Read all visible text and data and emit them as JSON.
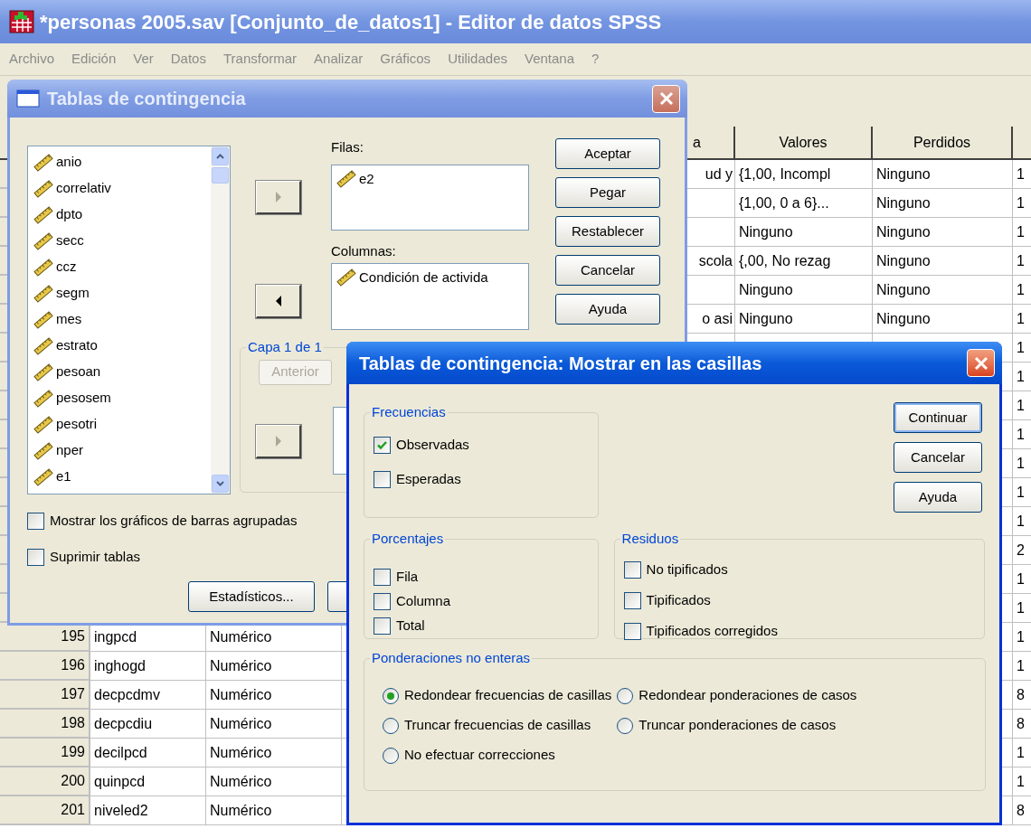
{
  "window": {
    "title": "*personas 2005.sav [Conjunto_de_datos1] - Editor de datos SPSS"
  },
  "menu": [
    "Archivo",
    "Edición",
    "Ver",
    "Datos",
    "Transformar",
    "Analizar",
    "Gráficos",
    "Utilidades",
    "Ventana",
    "?"
  ],
  "grid": {
    "headers": {
      "column_6": "a",
      "valores": "Valores",
      "perdidos": "Perdidos"
    },
    "rows": [
      {
        "column_6": "ud y",
        "valores": "{1,00, Incompl",
        "perdidos": "Ninguno",
        "column_9": "1"
      },
      {
        "valores": "{1,00, 0 a 6}...",
        "perdidos": "Ninguno",
        "column_9": "1"
      },
      {
        "valores": "Ninguno",
        "perdidos": "Ninguno",
        "column_9": "1"
      },
      {
        "column_6": "scola",
        "valores": "{,00, No rezag",
        "perdidos": "Ninguno",
        "column_9": "1"
      },
      {
        "valores": "Ninguno",
        "perdidos": "Ninguno",
        "column_9": "1"
      },
      {
        "column_6": "o asi",
        "valores": "Ninguno",
        "perdidos": "Ninguno",
        "column_9": "1"
      },
      {
        "column_9": "1"
      },
      {
        "column_9": "1"
      },
      {
        "column_9": "1"
      },
      {
        "column_9": "1"
      },
      {
        "column_9": "1"
      },
      {
        "column_9": "1"
      },
      {
        "column_9": "1"
      },
      {
        "column_9": "2"
      },
      {
        "column_9": "1"
      },
      {
        "column_9": "1"
      },
      {
        "number": "195",
        "name": "ingpcd",
        "type": "Numérico",
        "column_9": "1"
      },
      {
        "number": "196",
        "name": "inghogd",
        "type": "Numérico",
        "column_9": "1"
      },
      {
        "number": "197",
        "name": "decpcdmv",
        "type": "Numérico",
        "column_9": "8"
      },
      {
        "number": "198",
        "name": "decpcdiu",
        "type": "Numérico",
        "column_9": "8"
      },
      {
        "number": "199",
        "name": "decilpcd",
        "type": "Numérico",
        "column_9": "1"
      },
      {
        "number": "200",
        "name": "quinpcd",
        "type": "Numérico",
        "column_9": "1"
      },
      {
        "number": "201",
        "name": "niveled2",
        "type": "Numérico",
        "column_9": "8"
      }
    ]
  },
  "crosstabs_dialog": {
    "title": "Tablas de contingencia",
    "variables": [
      "anio",
      "correlativ",
      "dpto",
      "secc",
      "ccz",
      "segm",
      "mes",
      "estrato",
      "pesoan",
      "pesosem",
      "pesotri",
      "nper",
      "e1"
    ],
    "move_buttons": [
      {
        "kind": "right",
        "disabled": true
      },
      {
        "kind": "left",
        "disabled": false
      },
      {
        "kind": "right",
        "disabled": true
      }
    ],
    "rows_list": {
      "label": "Filas:",
      "items": [
        "e2"
      ]
    },
    "columns_list": {
      "label": "Columnas:",
      "items": [
        "Condición de activida"
      ]
    },
    "buttons": [
      "Aceptar",
      "Pegar",
      "Restablecer",
      "Cancelar",
      "Ayuda"
    ],
    "layer": {
      "label": "Capa 1 de 1",
      "previous": {
        "label": "Anterior",
        "disabled": true
      }
    },
    "options": [
      {
        "label": "Mostrar los gráficos de barras agrupadas",
        "checked": false
      },
      {
        "label": "Suprimir tablas",
        "checked": false
      }
    ],
    "bottom_buttons": [
      "Estadísticos..."
    ]
  },
  "cells_dialog": {
    "title": "Tablas de contingencia: Mostrar en las casillas",
    "frecuencias": {
      "label": "Frecuencias",
      "options": [
        {
          "label": "Observadas",
          "checked": true
        },
        {
          "label": "Esperadas",
          "checked": false
        }
      ]
    },
    "porcentajes": {
      "label": "Porcentajes",
      "options": [
        {
          "label": "Fila",
          "checked": false
        },
        {
          "label": "Columna",
          "checked": false
        },
        {
          "label": "Total",
          "checked": false
        }
      ]
    },
    "residuos": {
      "label": "Residuos",
      "options": [
        {
          "label": "No tipificados",
          "checked": false
        },
        {
          "label": "Tipificados",
          "checked": false
        },
        {
          "label": "Tipificados corregidos",
          "checked": false
        }
      ]
    },
    "ponderaciones": {
      "label": "Ponderaciones no enteras",
      "options": [
        {
          "label": "Redondear frecuencias de casillas",
          "selected": true
        },
        {
          "label": "Redondear ponderaciones de casos",
          "selected": false
        },
        {
          "label": "Truncar frecuencias de casillas",
          "selected": false
        },
        {
          "label": "Truncar ponderaciones de casos",
          "selected": false
        },
        {
          "label": "No efectuar correcciones",
          "selected": false
        }
      ]
    },
    "buttons": [
      {
        "label": "Continuar",
        "default": true
      },
      {
        "label": "Cancelar",
        "default": false
      },
      {
        "label": "Ayuda",
        "default": false
      }
    ]
  }
}
